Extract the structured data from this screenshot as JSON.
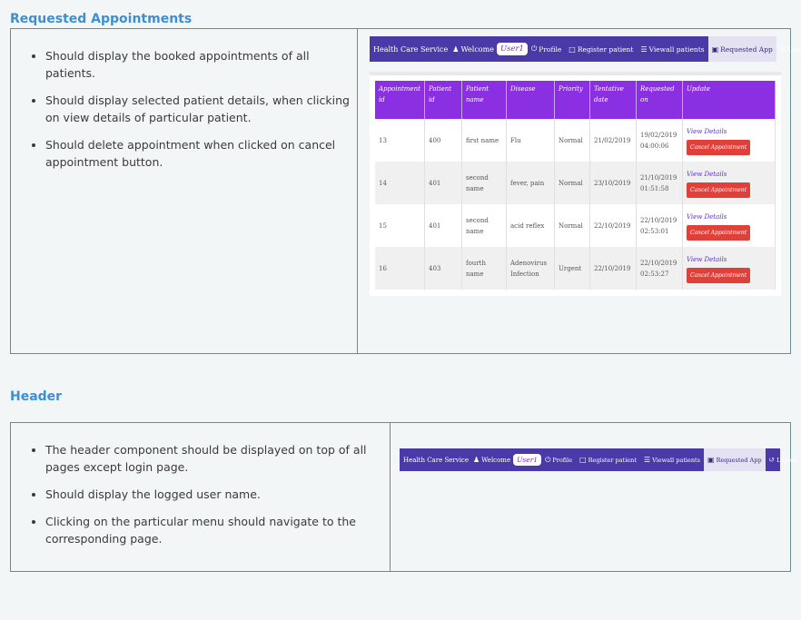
{
  "sections": {
    "requested": {
      "title": "Requested Appointments",
      "bullets": [
        "Should display the booked appointments of all patients.",
        "Should display selected patient details, when clicking on view details of particular patient.",
        "Should delete appointment when clicked on cancel appointment button."
      ]
    },
    "header": {
      "title": "Header",
      "bullets": [
        "The header component should be displayed on top of all pages except login page.",
        "Should display the logged user name.",
        "Clicking on the particular menu should navigate to the corresponding page."
      ]
    }
  },
  "app": {
    "brand": "Health Care Service",
    "welcome": "Welcome",
    "user": "User1",
    "menu": {
      "profile": "Profile",
      "register": "Register patient",
      "view_all": "Viewall patients",
      "requested": "Requested App",
      "logout": "Logout"
    },
    "icons": {
      "user": "person-icon",
      "profile": "power-icon",
      "register": "calendar-icon",
      "view_all": "list-icon",
      "requested": "calendar-icon",
      "logout": "logout-icon"
    },
    "colors": {
      "nav": "#4a3aa8",
      "table_header": "#8a2fe2",
      "cancel": "#e0403a"
    }
  },
  "table": {
    "headers": [
      "Appointment id",
      "Patient id",
      "Patient name",
      "Disease",
      "Priority",
      "Tentative date",
      "Requested on",
      "Update"
    ],
    "view_label": "View Details",
    "cancel_label": "Cancel Appointment",
    "rows": [
      {
        "appointment_id": "13",
        "patient_id": "400",
        "patient_name": "first name",
        "disease": "Flu",
        "priority": "Normal",
        "tentative_date": "21/02/2019",
        "requested_date": "19/02/2019",
        "requested_time": "04:00:06"
      },
      {
        "appointment_id": "14",
        "patient_id": "401",
        "patient_name": "second name",
        "disease": "fever, pain",
        "priority": "Normal",
        "tentative_date": "23/10/2019",
        "requested_date": "21/10/2019",
        "requested_time": "01:51:58"
      },
      {
        "appointment_id": "15",
        "patient_id": "401",
        "patient_name": "second name",
        "disease": "acid reflex",
        "priority": "Normal",
        "tentative_date": "22/10/2019",
        "requested_date": "22/10/2019",
        "requested_time": "02:53:01"
      },
      {
        "appointment_id": "16",
        "patient_id": "403",
        "patient_name": "fourth name",
        "disease": "Adenovirus Infection",
        "priority": "Urgent",
        "tentative_date": "22/10/2019",
        "requested_date": "22/10/2019",
        "requested_time": "02:53:27"
      }
    ]
  }
}
